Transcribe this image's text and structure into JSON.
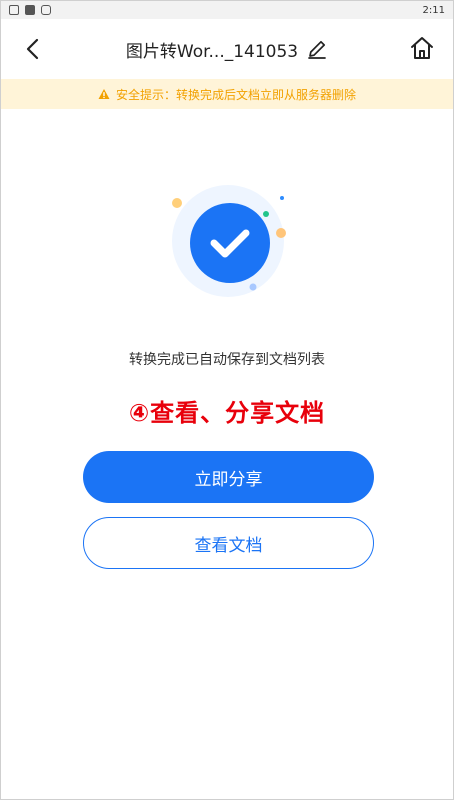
{
  "status_bar": {
    "time": "2:11"
  },
  "header": {
    "title": "图片转Wor..._141053",
    "back_icon": "chevron-left-icon",
    "edit_icon": "pencil-icon",
    "home_icon": "home-icon"
  },
  "notice": {
    "text": "安全提示：转换完成后文档立即从服务器删除",
    "icon": "warning-icon",
    "color": "#f2a100",
    "background": "#fff4d8"
  },
  "main": {
    "success_icon": "check-circle-icon",
    "success_text": "转换完成已自动保存到文档列表",
    "annotation": "④查看、分享文档",
    "share_button": "立即分享",
    "view_button": "查看文档"
  },
  "colors": {
    "accent": "#1b74f5",
    "annotation": "#e8000b"
  }
}
